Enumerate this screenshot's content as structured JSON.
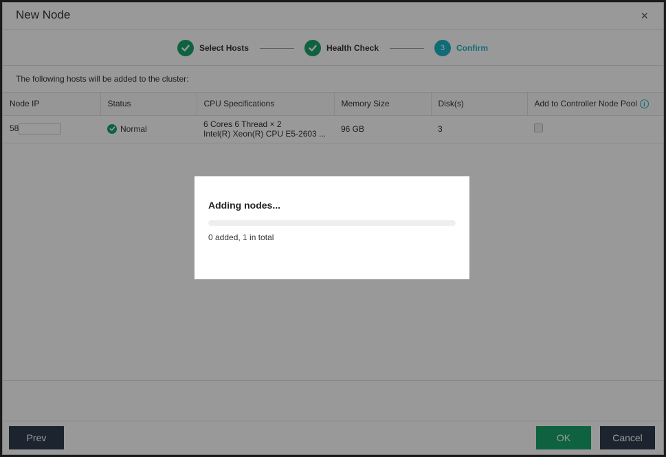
{
  "dialog": {
    "title": "New Node",
    "close_icon": "×"
  },
  "steps": [
    {
      "label": "Select Hosts",
      "state": "done"
    },
    {
      "label": "Health Check",
      "state": "done"
    },
    {
      "label": "Confirm",
      "number": "3",
      "state": "active"
    }
  ],
  "intro": "The following hosts will be added to the cluster:",
  "table": {
    "headers": [
      "Node IP",
      "Status",
      "CPU Specifications",
      "Memory Size",
      "Disk(s)",
      "Add to Controller Node Pool"
    ],
    "rows": [
      {
        "ip_prefix": "58",
        "status": "Normal",
        "cpu_line1": "6 Cores 6 Thread × 2",
        "cpu_line2": "Intel(R) Xeon(R) CPU E5-2603 ...",
        "memory": "96 GB",
        "disks": "3",
        "controller_pool_checked": true
      }
    ]
  },
  "footer": {
    "prev_label": "Prev",
    "ok_label": "OK",
    "cancel_label": "Cancel"
  },
  "modal": {
    "title": "Adding nodes...",
    "progress_fraction": 0,
    "status_text": "0 added, 1 in total"
  },
  "colors": {
    "success": "#1aa36b",
    "accent": "#19b3c5",
    "dark_button": "#2e3c4f"
  }
}
